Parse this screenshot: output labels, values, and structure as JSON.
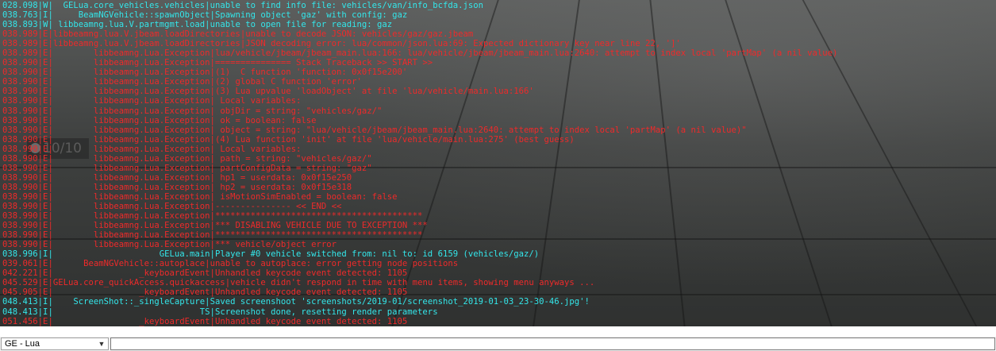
{
  "overlay": {
    "counter": "10/10"
  },
  "console_lines": [
    {
      "time": "028.098",
      "level": "W",
      "source": "  GELua.core_vehicles.vehicles",
      "message": "unable to find info file: vehicles/van/info_bcfda.json"
    },
    {
      "time": "038.763",
      "level": "I",
      "source": "     BeamNGVehicle::spawnObject",
      "message": "Spawning object 'gaz' with config: gaz"
    },
    {
      "time": "038.893",
      "level": "W",
      "source": " libbeamng.lua.V.partmgmt.load",
      "message": "unable to open file for reading: gaz"
    },
    {
      "time": "038.989",
      "level": "E",
      "source": "libbeamng.lua.V.jbeam.loadDirectories",
      "message": "unable to decode JSON: vehicles/gaz/gaz.jbeam"
    },
    {
      "time": "038.989",
      "level": "E",
      "source": "libbeamng.lua.V.jbeam.loadDirectories",
      "message": "JSON decoding error: lua/common/json.lua:69: Expected dictionary key near line 22, ']'"
    },
    {
      "time": "038.989",
      "level": "E",
      "source": "        libbeamng.Lua.Exception",
      "message": "lua/vehicle/jbeam/jbeam_main.lua:166: lua/vehicle/jbeam/jbeam_main.lua:2640: attempt to index local 'partMap' (a nil value)"
    },
    {
      "time": "038.990",
      "level": "E",
      "source": "        libbeamng.Lua.Exception",
      "message": "=============== Stack Traceback >> START >>"
    },
    {
      "time": "038.990",
      "level": "E",
      "source": "        libbeamng.Lua.Exception",
      "message": "(1)  C function 'function: 0x0f15e200'"
    },
    {
      "time": "038.990",
      "level": "E",
      "source": "        libbeamng.Lua.Exception",
      "message": "(2) global C function 'error'"
    },
    {
      "time": "038.990",
      "level": "E",
      "source": "        libbeamng.Lua.Exception",
      "message": "(3) Lua upvalue 'loadObject' at file 'lua/vehicle/main.lua:166'"
    },
    {
      "time": "038.990",
      "level": "E",
      "source": "        libbeamng.Lua.Exception",
      "message": " Local variables:"
    },
    {
      "time": "038.990",
      "level": "E",
      "source": "        libbeamng.Lua.Exception",
      "message": " objDir = string: \"vehicles/gaz/\""
    },
    {
      "time": "038.990",
      "level": "E",
      "source": "        libbeamng.Lua.Exception",
      "message": " ok = boolean: false"
    },
    {
      "time": "038.990",
      "level": "E",
      "source": "        libbeamng.Lua.Exception",
      "message": " object = string: \"lua/vehicle/jbeam/jbeam_main.lua:2640: attempt to index local 'partMap' (a nil value)\""
    },
    {
      "time": "038.990",
      "level": "E",
      "source": "        libbeamng.Lua.Exception",
      "message": "(4) Lua function 'init' at file 'lua/vehicle/main.lua:275' (best guess)"
    },
    {
      "time": "038.990",
      "level": "E",
      "source": "        libbeamng.Lua.Exception",
      "message": " Local variables:"
    },
    {
      "time": "038.990",
      "level": "E",
      "source": "        libbeamng.Lua.Exception",
      "message": " path = string: \"vehicles/gaz/\""
    },
    {
      "time": "038.990",
      "level": "E",
      "source": "        libbeamng.Lua.Exception",
      "message": " partConfigData = string: \"gaz\""
    },
    {
      "time": "038.990",
      "level": "E",
      "source": "        libbeamng.Lua.Exception",
      "message": " hp1 = userdata: 0x0f15e250"
    },
    {
      "time": "038.990",
      "level": "E",
      "source": "        libbeamng.Lua.Exception",
      "message": " hp2 = userdata: 0x0f15e318"
    },
    {
      "time": "038.990",
      "level": "E",
      "source": "        libbeamng.Lua.Exception",
      "message": " isMotionSimEnabled = boolean: false"
    },
    {
      "time": "038.990",
      "level": "E",
      "source": "        libbeamng.Lua.Exception",
      "message": "--------------- << END <<"
    },
    {
      "time": "038.990",
      "level": "E",
      "source": "        libbeamng.Lua.Exception",
      "message": "*****************************************"
    },
    {
      "time": "038.990",
      "level": "E",
      "source": "        libbeamng.Lua.Exception",
      "message": "*** DISABLING VEHICLE DUE TO EXCEPTION ***"
    },
    {
      "time": "038.990",
      "level": "E",
      "source": "        libbeamng.Lua.Exception",
      "message": "*****************************************"
    },
    {
      "time": "038.990",
      "level": "E",
      "source": "        libbeamng.Lua.Exception",
      "message": "*** vehicle/object error"
    },
    {
      "time": "038.996",
      "level": "I",
      "source": "                     GELua.main",
      "message": "Player #0 vehicle switched from: nil to: id 6159 (vehicles/gaz/)"
    },
    {
      "time": "039.061",
      "level": "E",
      "source": "      BeamNGVehicle::autoplace",
      "message": "unable to autoplace: error getting node positions"
    },
    {
      "time": "042.221",
      "level": "E",
      "source": "                 _keyboardEvent",
      "message": "Unhandled keycode event detected: 1105"
    },
    {
      "time": "045.529",
      "level": "E",
      "source": "GELua.core_quickAccess.quickaccess",
      "message": "vehicle didn't respond in time with menu items, showing menu anyways ..."
    },
    {
      "time": "045.905",
      "level": "E",
      "source": "                 _keyboardEvent",
      "message": "Unhandled keycode event detected: 1105"
    },
    {
      "time": "048.413",
      "level": "I",
      "source": "    ScreenShot::_singleCapture",
      "message": "Saved screenshoot 'screenshots/2019-01/screenshot_2019-01-03_23-30-46.jpg'!"
    },
    {
      "time": "048.413",
      "level": "I",
      "source": "                             TS",
      "message": "Screenshot done, resetting render parameters"
    },
    {
      "time": "051.456",
      "level": "E",
      "source": "                 _keyboardEvent",
      "message": "Unhandled keycode event detected: 1105"
    }
  ],
  "toolbar": {
    "context_select": {
      "selected": "GE - Lua"
    },
    "command_input": {
      "value": "",
      "placeholder": ""
    }
  }
}
